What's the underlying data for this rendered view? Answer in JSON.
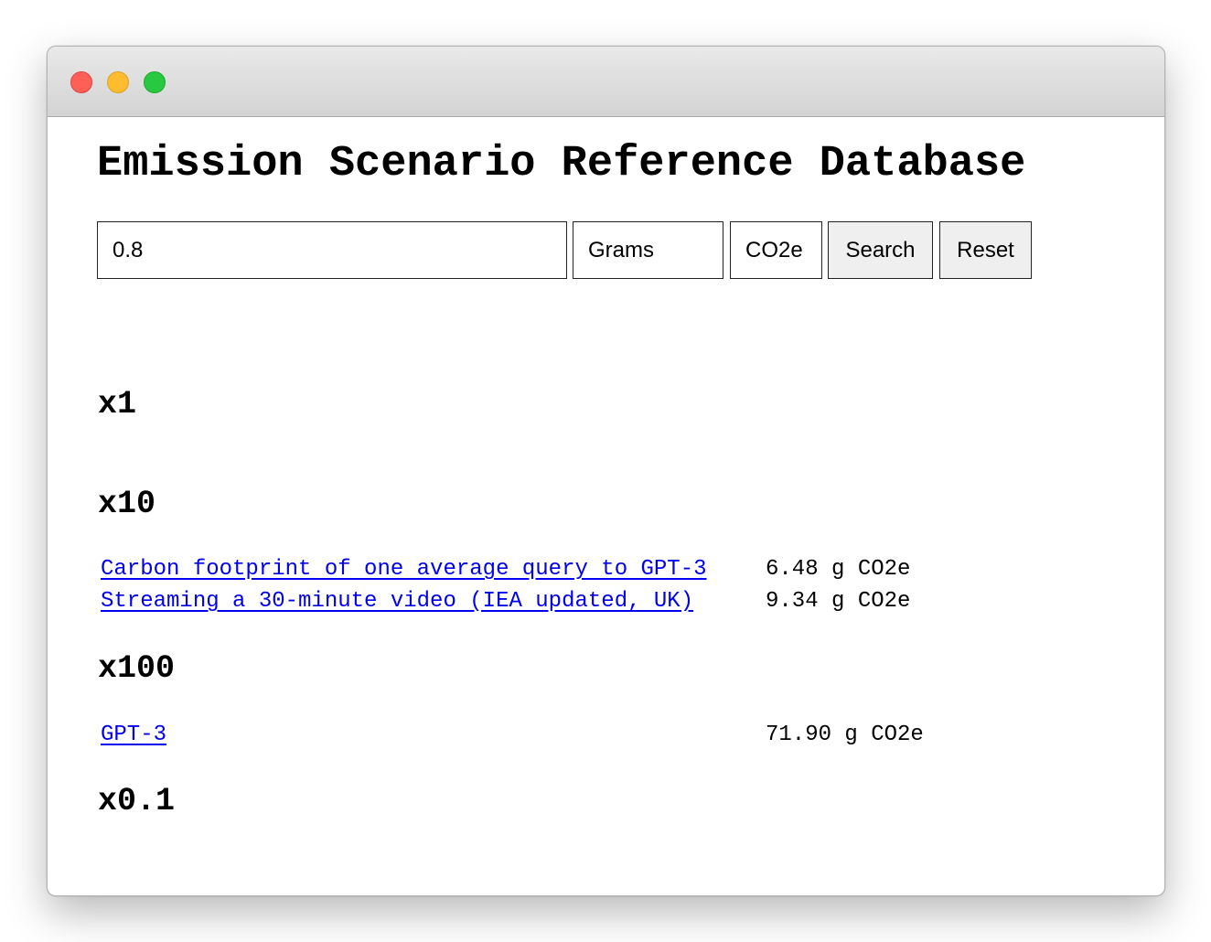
{
  "page": {
    "title": "Emission Scenario Reference Database"
  },
  "search": {
    "amount": "0.8",
    "unit": "Grams",
    "gas": "CO2e",
    "search_label": "Search",
    "reset_label": "Reset"
  },
  "results": [
    {
      "label": "x1",
      "items": []
    },
    {
      "label": "x10",
      "items": [
        {
          "name": "Carbon footprint of one average query to GPT-3",
          "value": "6.48 g CO2e"
        },
        {
          "name": "Streaming a 30-minute video (IEA updated, UK)",
          "value": "9.34 g CO2e"
        }
      ]
    },
    {
      "label": "x100",
      "items": [
        {
          "name": "GPT-3",
          "value": "71.90 g CO2e"
        }
      ]
    },
    {
      "label": "x0.1",
      "items": []
    }
  ]
}
